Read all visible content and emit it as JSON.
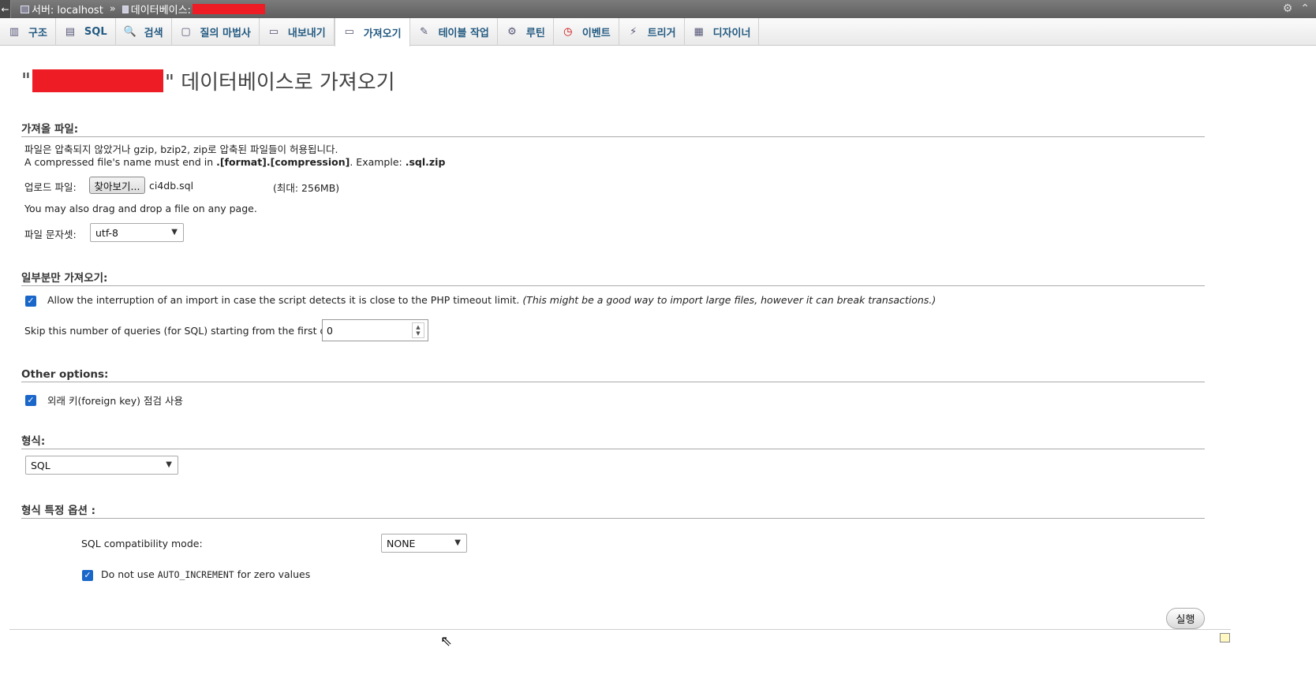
{
  "topbar": {
    "back": "←",
    "server_label": "서버: localhost",
    "separator": "»",
    "db_label": "데이터베이스:",
    "settings_icon": "⚙",
    "collapse_icon": "⌃"
  },
  "tabs": [
    {
      "label": "구조",
      "icon": "▥"
    },
    {
      "label": "SQL",
      "icon": "▤"
    },
    {
      "label": "검색",
      "icon": "🔍"
    },
    {
      "label": "질의 마법사",
      "icon": "▢"
    },
    {
      "label": "내보내기",
      "icon": "▭"
    },
    {
      "label": "가져오기",
      "icon": "▭"
    },
    {
      "label": "테이블 작업",
      "icon": "✎"
    },
    {
      "label": "루틴",
      "icon": "⚙"
    },
    {
      "label": "이벤트",
      "icon": "◷"
    },
    {
      "label": "트리거",
      "icon": "⚡"
    },
    {
      "label": "디자이너",
      "icon": "▦"
    }
  ],
  "page": {
    "title_prefix": "\"",
    "title_suffix": "\" 데이터베이스로 가져오기"
  },
  "file_section": {
    "heading": "가져올 파일:",
    "line1": "파일은 압축되지 않았거나 gzip, bzip2, zip로 압축된 파일들이 허용됩니다.",
    "line2_pre": "A compressed file's name must end in ",
    "line2_bold": ".[format].[compression]",
    "line2_mid": ". Example: ",
    "line2_ex": ".sql.zip",
    "upload_label": "업로드 파일:",
    "browse_button": "찾아보기...",
    "file_name": "ci4db.sql",
    "max_size": "(최대: 256MB)",
    "drag_note": "You may also drag and drop a file on any page.",
    "charset_label": "파일 문자셋:",
    "charset_value": "utf-8"
  },
  "partial_section": {
    "heading": "일부분만 가져오기:",
    "allow_interrupt": "Allow the interruption of an import in case the script detects it is close to the PHP timeout limit.",
    "allow_interrupt_note": "(This might be a good way to import large files, however it can break transactions.)",
    "skip_label": "Skip this number of queries (for SQL) starting from the first one:",
    "skip_value": "0"
  },
  "other_section": {
    "heading": "Other options:",
    "fk_check": "외래 키(foreign key) 점검 사용"
  },
  "format_section": {
    "heading": "형식:",
    "format_value": "SQL"
  },
  "format_options": {
    "heading": "형식 특정 옵션 :",
    "compat_label": "SQL compatibility mode:",
    "compat_value": "NONE",
    "no_auto_inc_pre": "Do not use ",
    "no_auto_inc_code": "AUTO_INCREMENT",
    "no_auto_inc_post": " for zero values"
  },
  "submit_label": "실행",
  "colors": {
    "tab_text": "#235a81",
    "checkbox": "#1a67c9",
    "redaction": "#ee1c24"
  }
}
